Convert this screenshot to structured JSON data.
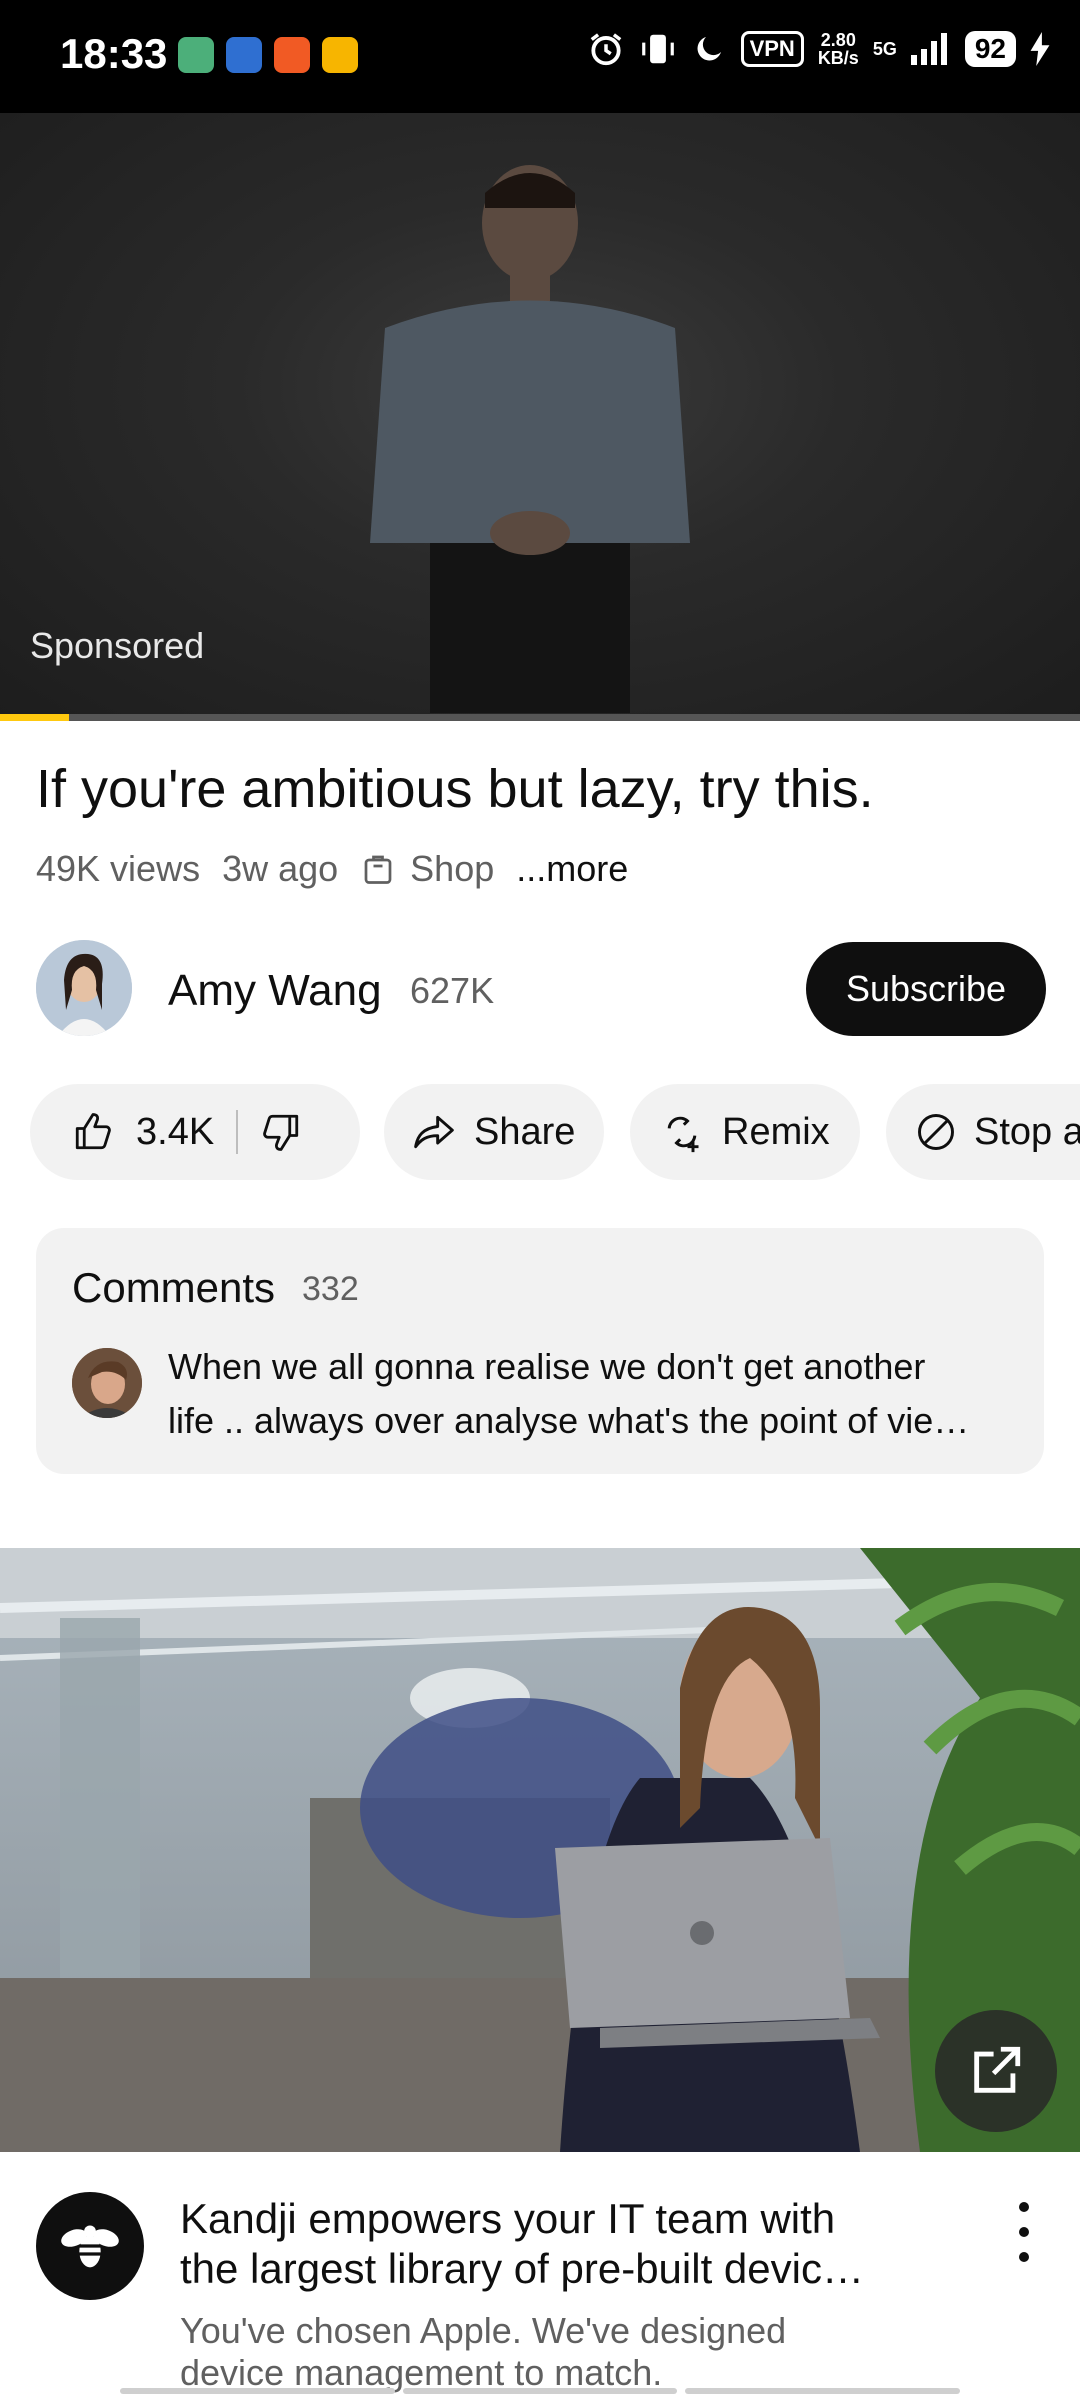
{
  "status_bar": {
    "time": "18:33",
    "vpn": "VPN",
    "speed_value": "2.80",
    "speed_unit": "KB/s",
    "network": "5G",
    "battery": "92",
    "icons": [
      "app-icon-green",
      "app-icon-blue",
      "app-icon-orange",
      "app-icon-yellow",
      "alarm-icon",
      "vibrate-icon",
      "moon-icon",
      "signal-icon",
      "charging-icon"
    ]
  },
  "video": {
    "sponsored_label": "Sponsored",
    "progress_fraction": 0.064,
    "progress_color": "#ffc90f"
  },
  "details": {
    "title": "If you're ambitious but lazy, try this.",
    "views": "49K views",
    "age": "3w ago",
    "shop_label": "Shop",
    "more_label": "...more"
  },
  "channel": {
    "name": "Amy Wang",
    "subscribers": "627K",
    "subscribe_label": "Subscribe"
  },
  "actions": {
    "like_count": "3.4K",
    "share_label": "Share",
    "remix_label": "Remix",
    "stop_ads_label": "Stop a"
  },
  "comments": {
    "title": "Comments",
    "count": "332",
    "top_comment_line1": "When we all gonna realise we don't get another",
    "top_comment_line2": "life .. always over analyse what's the point of vie…"
  },
  "ad": {
    "headline_line1": "Kandji empowers your IT team with",
    "headline_line2": "the largest library of pre-built devic…",
    "description_line1": "You've chosen Apple. We've designed",
    "description_line2": "device management to match.",
    "logo_icon": "bee-icon",
    "brand_color": "#0f0f0f"
  },
  "colors": {
    "accent": "#ffc90f",
    "text_primary": "#0f0f0f",
    "text_secondary": "#606060",
    "pill_bg": "#f2f2f2"
  }
}
